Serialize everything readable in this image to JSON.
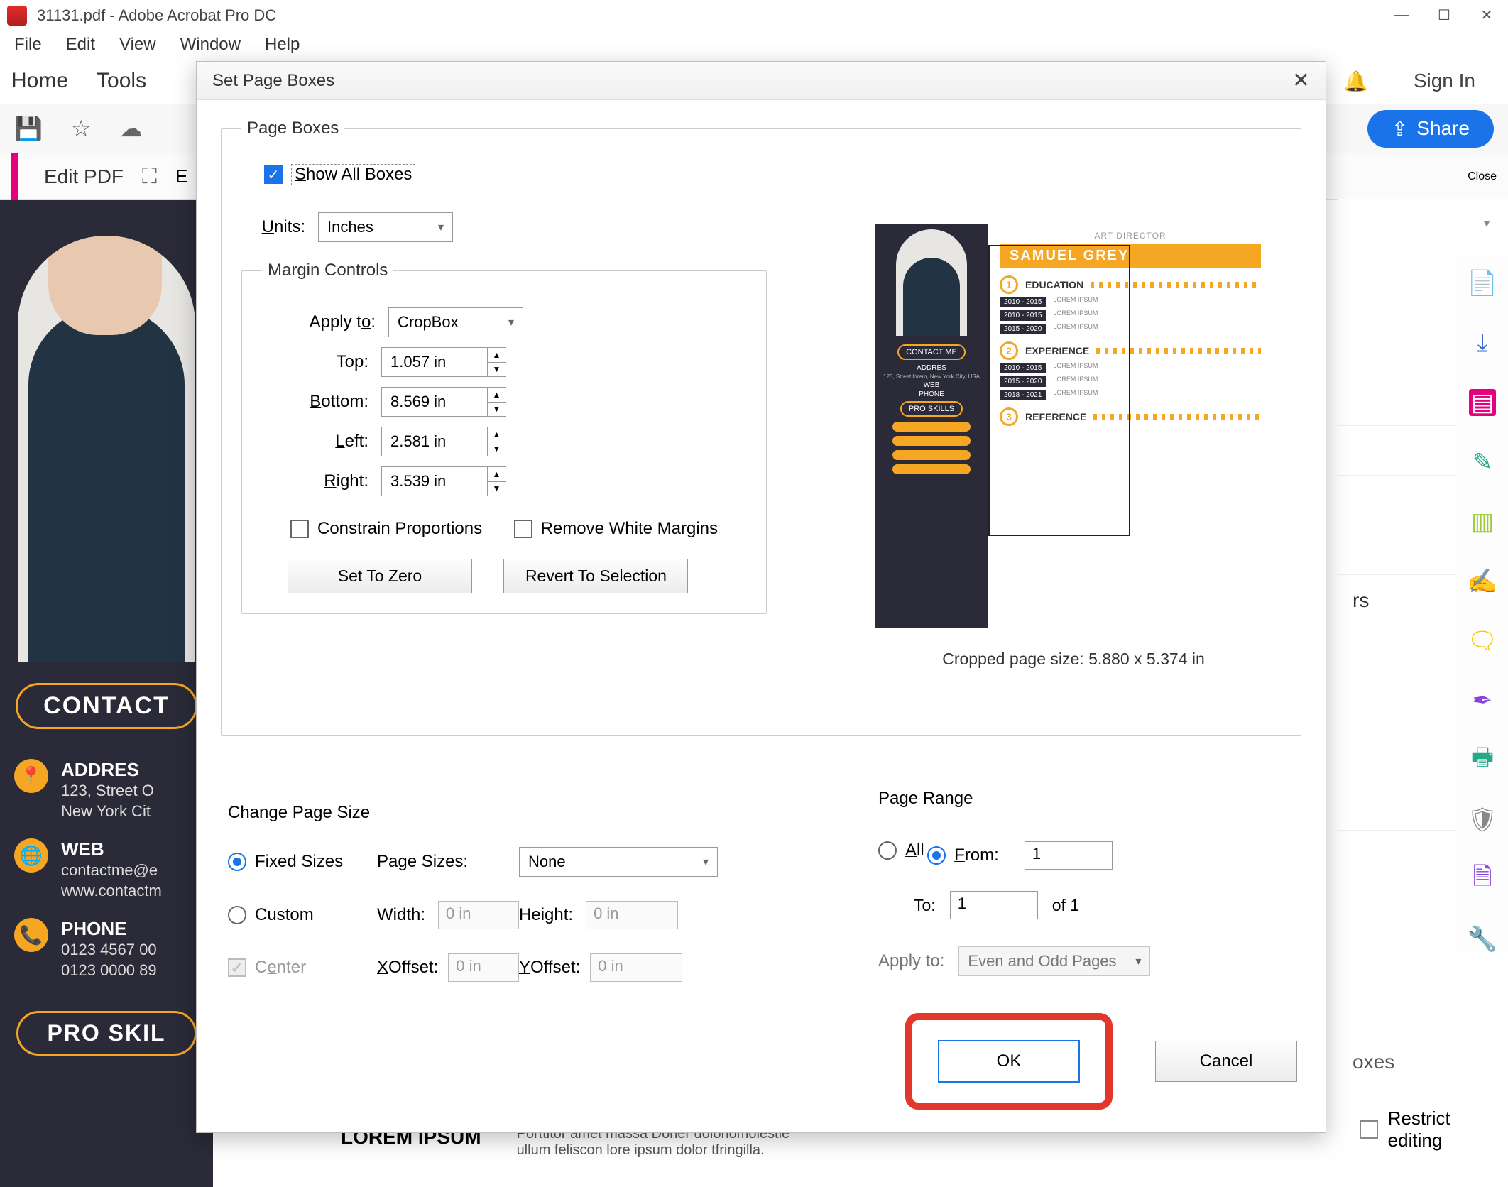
{
  "titlebar": {
    "title": "31131.pdf - Adobe Acrobat Pro DC"
  },
  "menubar": {
    "file": "File",
    "edit": "Edit",
    "view": "View",
    "window": "Window",
    "help": "Help"
  },
  "tabs": {
    "home": "Home",
    "tools": "Tools",
    "bell": "🔔",
    "signin": "Sign In"
  },
  "toolbar": {
    "share": "Share",
    "close": "Close"
  },
  "toolbar2": {
    "editpdf": "Edit PDF",
    "edit_prefix": "E"
  },
  "dialog": {
    "title": "Set Page Boxes",
    "page_boxes": {
      "legend": "Page Boxes",
      "show_all": "Show All Boxes",
      "units_label": "Units:",
      "units_value": "Inches",
      "margin_legend": "Margin Controls",
      "apply_to_label": "Apply to:",
      "apply_to_value": "CropBox",
      "top_label": "Top:",
      "top_value": "1.057 in",
      "bottom_label": "Bottom:",
      "bottom_value": "8.569 in",
      "left_label": "Left:",
      "left_value": "2.581 in",
      "right_label": "Right:",
      "right_value": "3.539 in",
      "constrain": "Constrain Proportions",
      "remove_white": "Remove White Margins",
      "set_zero": "Set To Zero",
      "revert": "Revert To Selection"
    },
    "preview": {
      "art_director": "ART DIRECTOR",
      "name": "SAMUEL GREY",
      "sec1": "EDUCATION",
      "sec2": "EXPERIENCE",
      "sec3": "REFERENCE",
      "contact": "CONTACT ME",
      "skills": "PRO SKILLS",
      "caption": "Cropped page size: 5.880 x 5.374 in",
      "addres_h": "ADDRES",
      "addres_t": "123, Street lorem, New York City, USA",
      "web_h": "WEB",
      "phone_h": "PHONE",
      "lorem_h": "LOREM IPSUM",
      "entry": "LOREM IPSUM"
    },
    "change_size": {
      "heading": "Change Page Size",
      "fixed": "Fixed Sizes",
      "custom": "Custom",
      "center": "Center",
      "page_sizes_label": "Page Sizes:",
      "page_sizes_value": "None",
      "width_label": "Width:",
      "width_value": "0 in",
      "height_label": "Height:",
      "height_value": "0 in",
      "xoffset_label": "XOffset:",
      "xoffset_value": "0 in",
      "yoffset_label": "YOffset:",
      "yoffset_value": "0 in"
    },
    "page_range": {
      "heading": "Page Range",
      "all": "All",
      "from": "From:",
      "from_value": "1",
      "to_label": "To:",
      "to_value": "1",
      "of_label": "of 1",
      "apply_to": "Apply to:",
      "apply_value": "Even and Odd Pages"
    },
    "buttons": {
      "ok": "OK",
      "cancel": "Cancel"
    }
  },
  "background_doc": {
    "contact_pill": "CONTACT",
    "addres_h": "ADDRES",
    "addres_t1": "123, Street O",
    "addres_t2": "New York Cit",
    "web_h": "WEB",
    "web_t1": "contactme@e",
    "web_t2": "www.contactm",
    "phone_h": "PHONE",
    "phone_t1": "0123 4567 00",
    "phone_t2": "0123 0000 89",
    "skills": "PRO SKIL",
    "lorem_h": "LOREM IPSUM",
    "lorem_p": "Porttitor amet massa Doner dolorlomolestie ullum feliscon lore  ipsum dolor tfringilla."
  },
  "right_panel": {
    "restrict": "Restrict editing",
    "boxes_hint": "oxes",
    "rs_hint": "rs"
  }
}
